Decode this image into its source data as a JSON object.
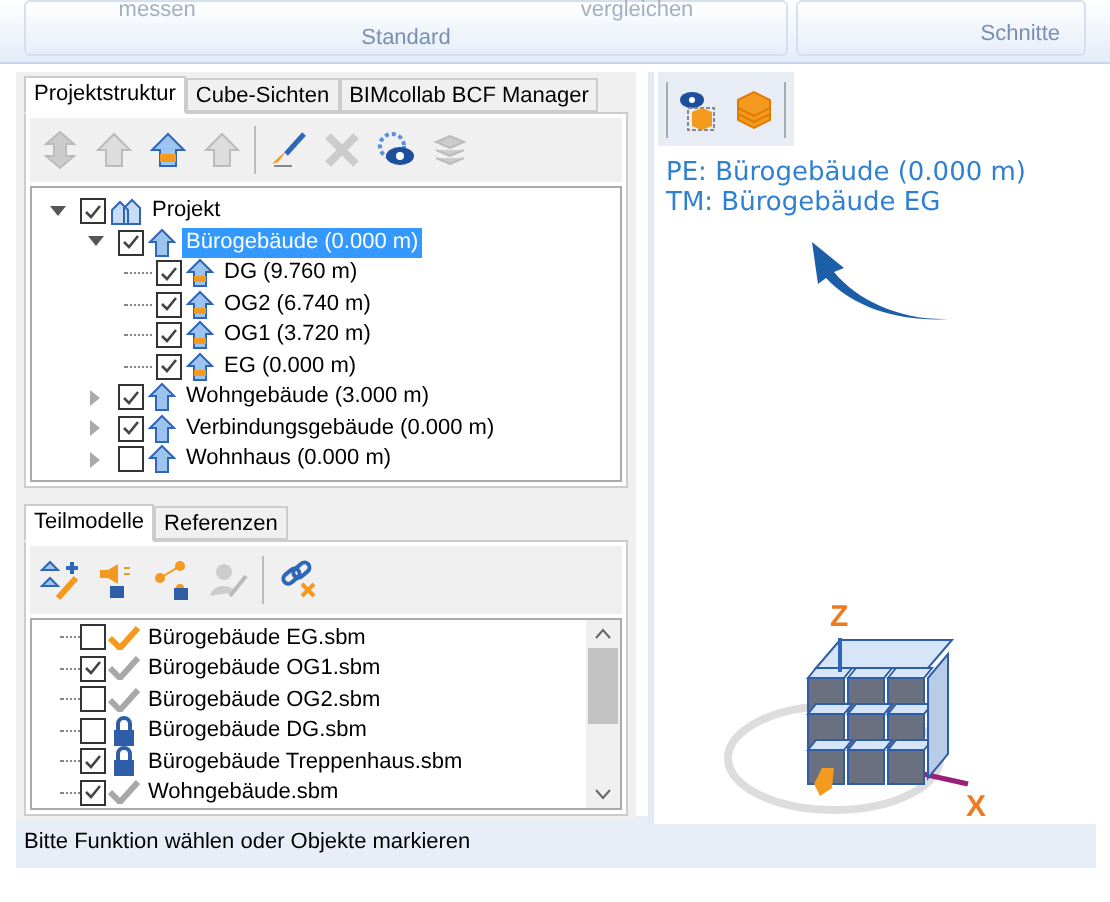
{
  "ribbon": {
    "faded_labels": [
      "messen",
      "vergleichen"
    ],
    "groups": [
      "Standard",
      "Schnitte"
    ]
  },
  "left_panel": {
    "tabs": [
      {
        "label": "Projektstruktur",
        "selected": true
      },
      {
        "label": "Cube-Sichten",
        "selected": false
      },
      {
        "label": "BIMcollab BCF Manager",
        "selected": false
      }
    ],
    "tree": [
      {
        "label": "Projekt",
        "kind": "project",
        "checked": true,
        "expanded": true,
        "selected": false,
        "children": [
          {
            "label": "Bürogebäude (0.000 m)",
            "kind": "building",
            "checked": true,
            "expanded": true,
            "selected": true,
            "children": [
              {
                "label": "DG (9.760 m)",
                "kind": "floor",
                "checked": true,
                "selected": false
              },
              {
                "label": "OG2 (6.740 m)",
                "kind": "floor",
                "checked": true,
                "selected": false
              },
              {
                "label": "OG1 (3.720 m)",
                "kind": "floor",
                "checked": true,
                "selected": false
              },
              {
                "label": "EG (0.000 m)",
                "kind": "floor",
                "checked": true,
                "selected": false
              }
            ]
          },
          {
            "label": "Wohngebäude (3.000 m)",
            "kind": "building",
            "checked": true,
            "expanded": false,
            "selected": false
          },
          {
            "label": "Verbindungsgebäude (0.000 m)",
            "kind": "building",
            "checked": true,
            "expanded": false,
            "selected": false
          },
          {
            "label": "Wohnhaus (0.000 m)",
            "kind": "building",
            "checked": false,
            "expanded": false,
            "selected": false
          }
        ]
      }
    ],
    "sub_tabs": [
      {
        "label": "Teilmodelle",
        "selected": true
      },
      {
        "label": "Referenzen",
        "selected": false
      }
    ],
    "submodels": [
      {
        "label": "Bürogebäude EG.sbm",
        "checked": false,
        "kind": "active"
      },
      {
        "label": "Bürogebäude OG1.sbm",
        "checked": true,
        "kind": "loaded"
      },
      {
        "label": "Bürogebäude OG2.sbm",
        "checked": false,
        "kind": "loaded"
      },
      {
        "label": "Bürogebäude DG.sbm",
        "checked": false,
        "kind": "locked"
      },
      {
        "label": "Bürogebäude Treppenhaus.sbm",
        "checked": true,
        "kind": "locked"
      },
      {
        "label": "Wohngebäude.sbm",
        "checked": true,
        "kind": "loaded"
      }
    ]
  },
  "view": {
    "info": [
      "PE: Bürogebäude (0.000 m)",
      "TM: Bürogebäude EG"
    ],
    "axes": [
      "Z",
      "X"
    ]
  },
  "status_bar": "Bitte Funktion wählen oder Objekte markieren"
}
